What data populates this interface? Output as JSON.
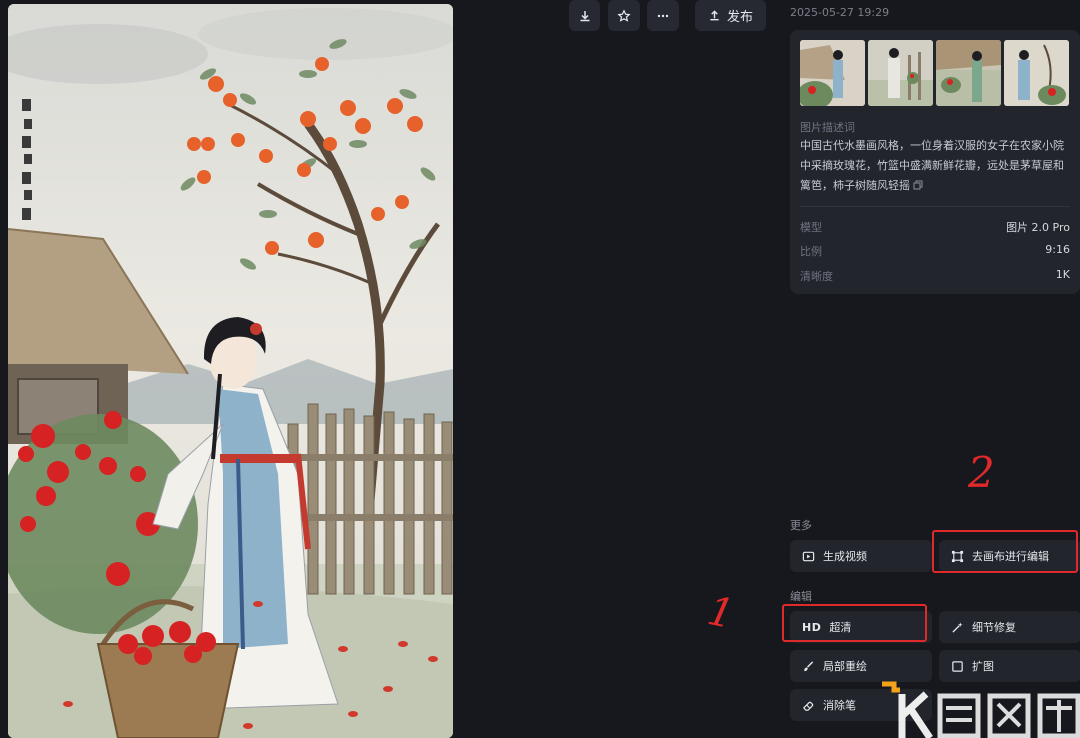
{
  "toolbar": {
    "download_icon": "download-icon",
    "favorite_icon": "star-icon",
    "more_icon": "ellipsis-icon",
    "publish_label": "发布"
  },
  "timestamp": "2025-05-27 19:29",
  "info": {
    "thumbnails": [
      "thumb-1",
      "thumb-2",
      "thumb-3",
      "thumb-4"
    ],
    "description_label": "图片描述词",
    "description_text": "中国古代水墨画风格，一位身着汉服的女子在农家小院中采摘玫瑰花，竹篮中盛满新鲜花瓣，远处是茅草屋和篱笆，柿子树随风轻摇",
    "meta": [
      {
        "key": "模型",
        "value": "图片 2.0 Pro"
      },
      {
        "key": "比例",
        "value": "9:16"
      },
      {
        "key": "清晰度",
        "value": "1K"
      }
    ]
  },
  "sections": {
    "more_label": "更多",
    "edit_label": "编辑"
  },
  "actions": {
    "generate_video": "生成视频",
    "edit_on_canvas": "去画布进行编辑",
    "hd_glyph": "HD",
    "upscale": "超清",
    "detail_repair": "细节修复",
    "inpaint": "局部重绘",
    "expand": "扩图",
    "eraser": "消除笔"
  },
  "annotations": {
    "num_1": "1",
    "num_2": "2"
  },
  "colors": {
    "background": "#16181d",
    "card": "#22252c",
    "highlight": "#e0292b"
  }
}
